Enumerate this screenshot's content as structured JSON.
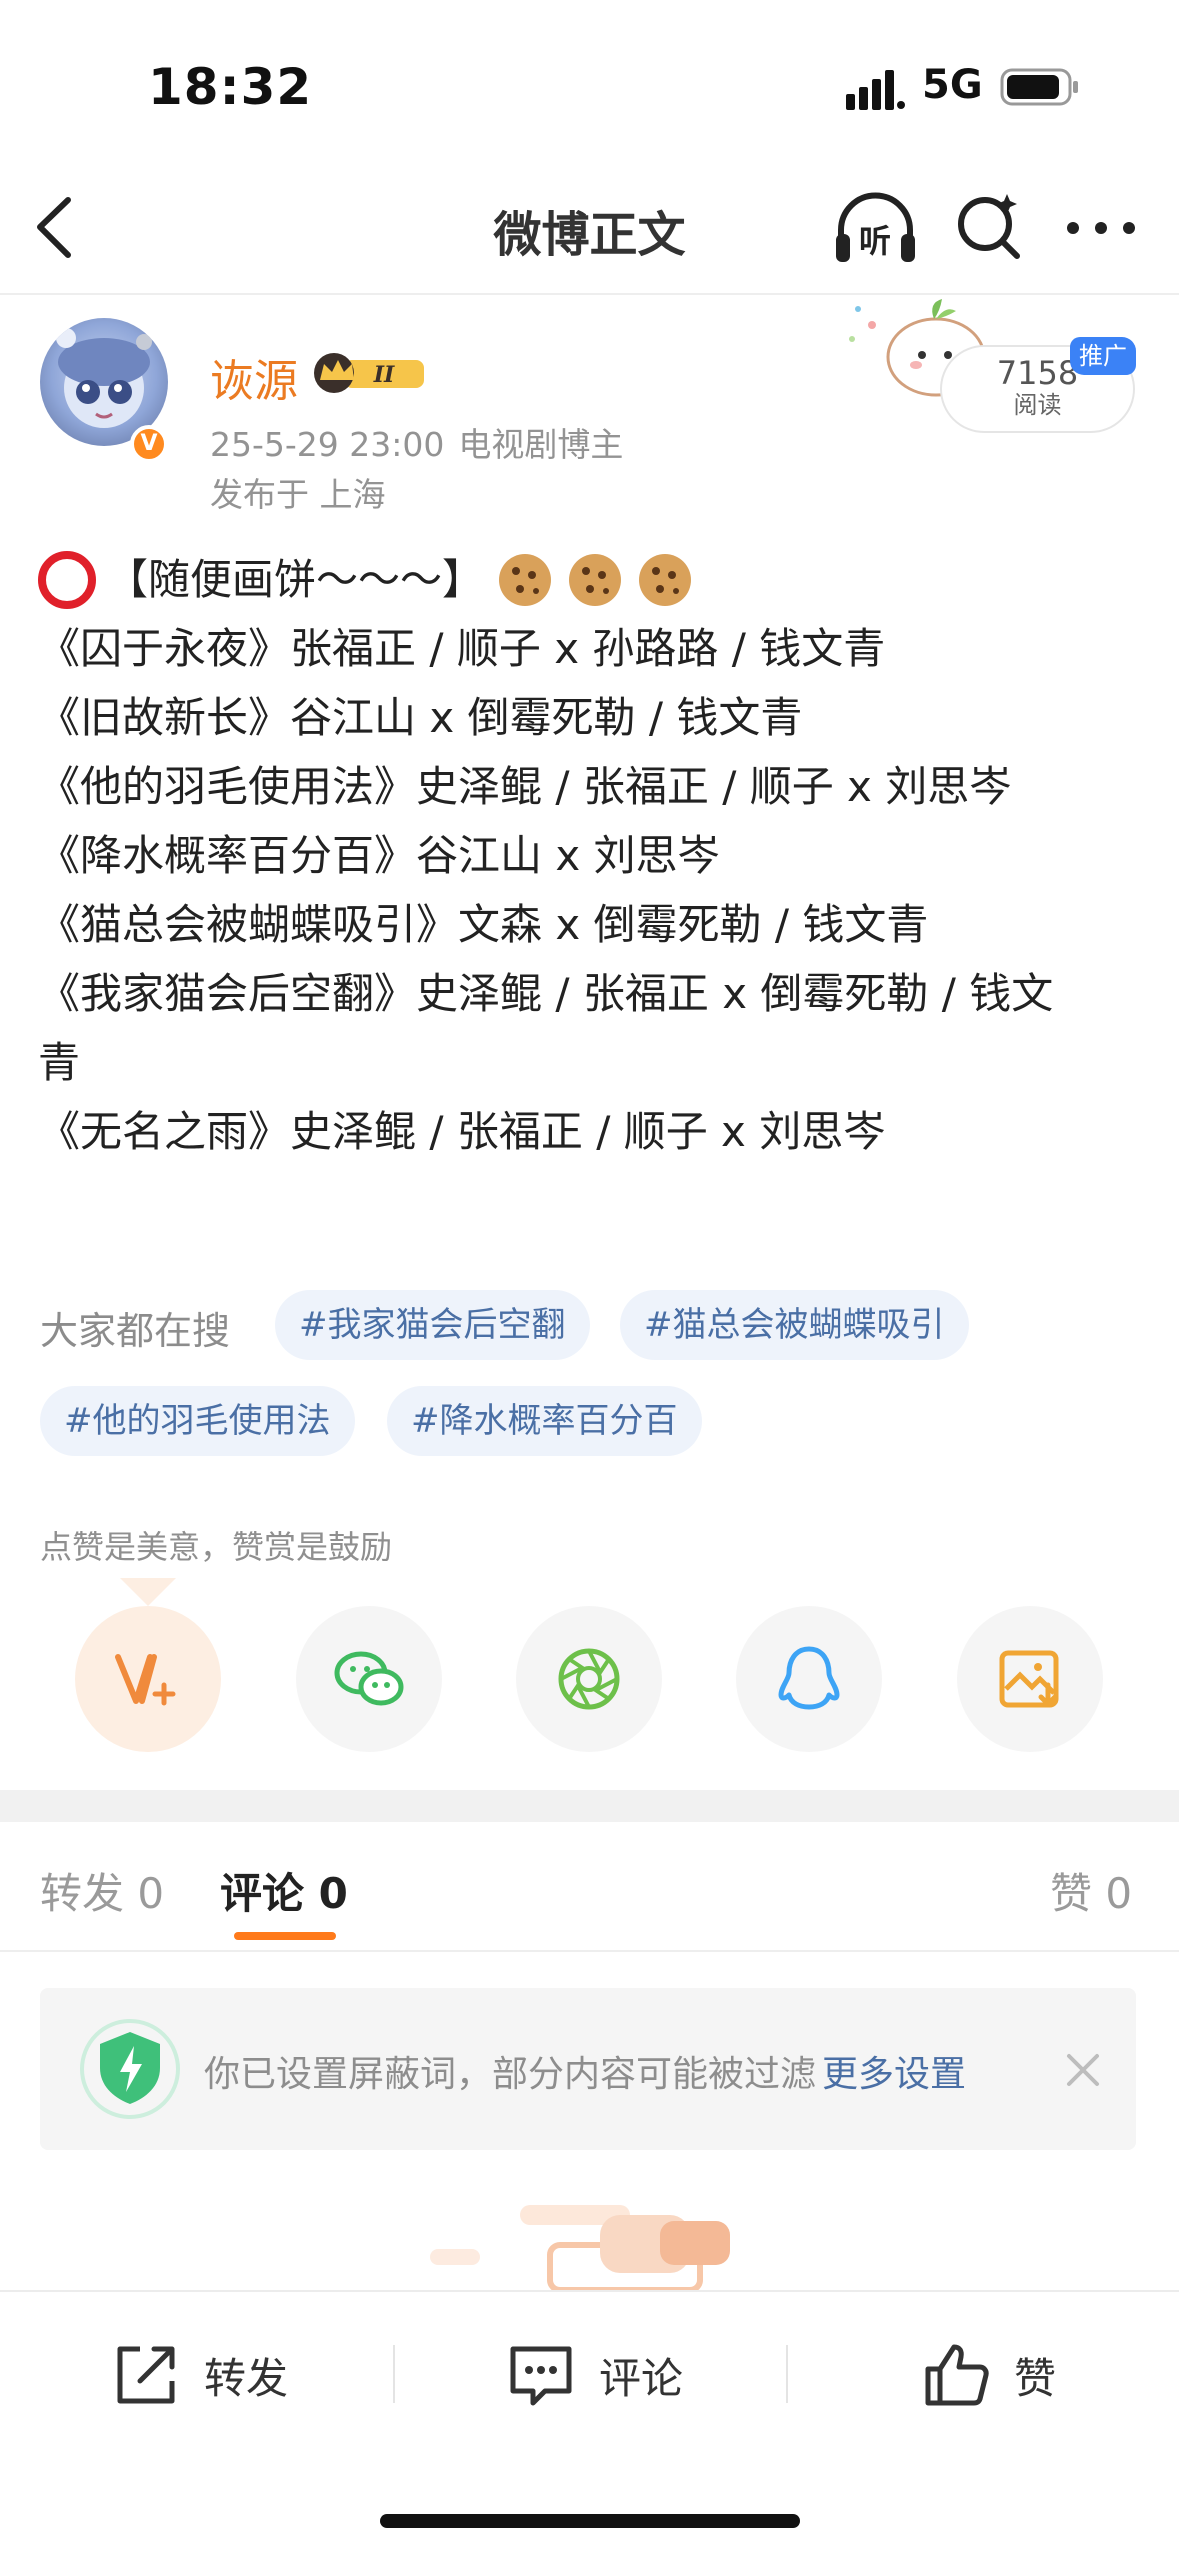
{
  "status_bar": {
    "time": "18:32",
    "network": "5G"
  },
  "nav": {
    "title": "微博正文",
    "listen_label": "听"
  },
  "author": {
    "name": "诙源",
    "level_badge": "II",
    "date": "25-5-29 23:00",
    "role": "电视剧博主",
    "location": "发布于 上海",
    "verified_mark": "V"
  },
  "promo": {
    "reads": "7158",
    "reads_label": "阅读",
    "tag": "推广"
  },
  "post": {
    "title": "【随便画饼～～～】",
    "lines": [
      "",
      "《囚于永夜》张福正 / 顺子 x 孙路路 / 钱文青",
      "《旧故新长》谷江山 x 倒霉死勒 / 钱文青",
      "《他的羽毛使用法》史泽鲲 / 张福正 / 顺子 x 刘思岑",
      "《降水概率百分百》谷江山 x 刘思岑",
      "《猫总会被蝴蝶吸引》文森 x 倒霉死勒 / 钱文青",
      "《我家猫会后空翻》史泽鲲 / 张福正 x 倒霉死勒 / 钱文",
      "青",
      "《无名之雨》史泽鲲 / 张福正 / 顺子 x 刘思岑"
    ]
  },
  "hot_search": {
    "label": "大家都在搜",
    "tags": [
      "#我家猫会后空翻",
      "#猫总会被蝴蝶吸引",
      "#他的羽毛使用法",
      "#降水概率百分百"
    ]
  },
  "tip": "点赞是美意，赞赏是鼓励",
  "tabs": {
    "repost": "转发 0",
    "comment": "评论 0",
    "like": "赞 0"
  },
  "notice": {
    "text": "你已设置屏蔽词，部分内容可能被过滤",
    "link": "更多设置"
  },
  "bottom_bar": {
    "repost": "转发",
    "comment": "评论",
    "like": "赞"
  },
  "colors": {
    "accent": "#ff7a1a",
    "author": "#eb7b22",
    "link": "#4a6fa5",
    "wechat": "#3fba5f",
    "qq": "#3da4f5",
    "gallery": "#f0a534"
  }
}
